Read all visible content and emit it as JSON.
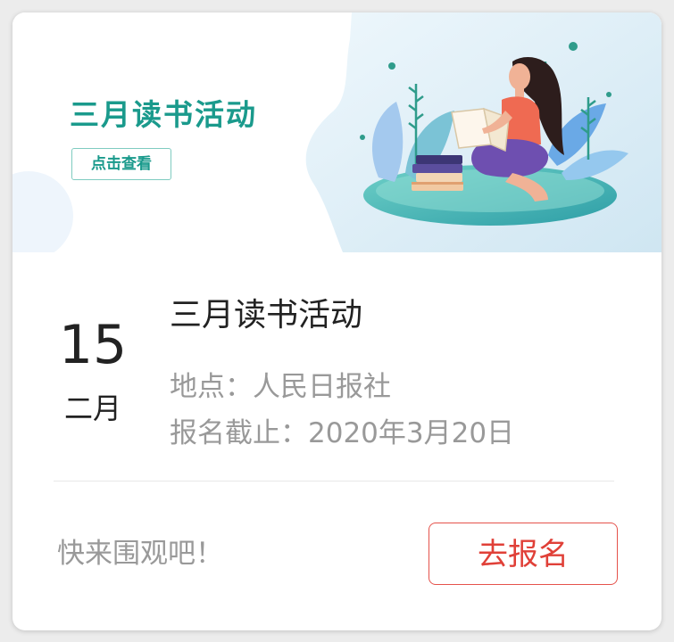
{
  "banner": {
    "title": "三月读书活动",
    "button_label": "点击查看",
    "colors": {
      "accent": "#1a9a8c",
      "water": "#5bbdc0",
      "sky": "#dff0f8"
    }
  },
  "event": {
    "day": "15",
    "month": "二月",
    "title": "三月读书活动",
    "location": "地点：人民日报社",
    "deadline": "报名截止：2020年3月20日"
  },
  "footer": {
    "text": "快来围观吧！",
    "signup_label": "去报名",
    "signup_color": "#e04038"
  }
}
